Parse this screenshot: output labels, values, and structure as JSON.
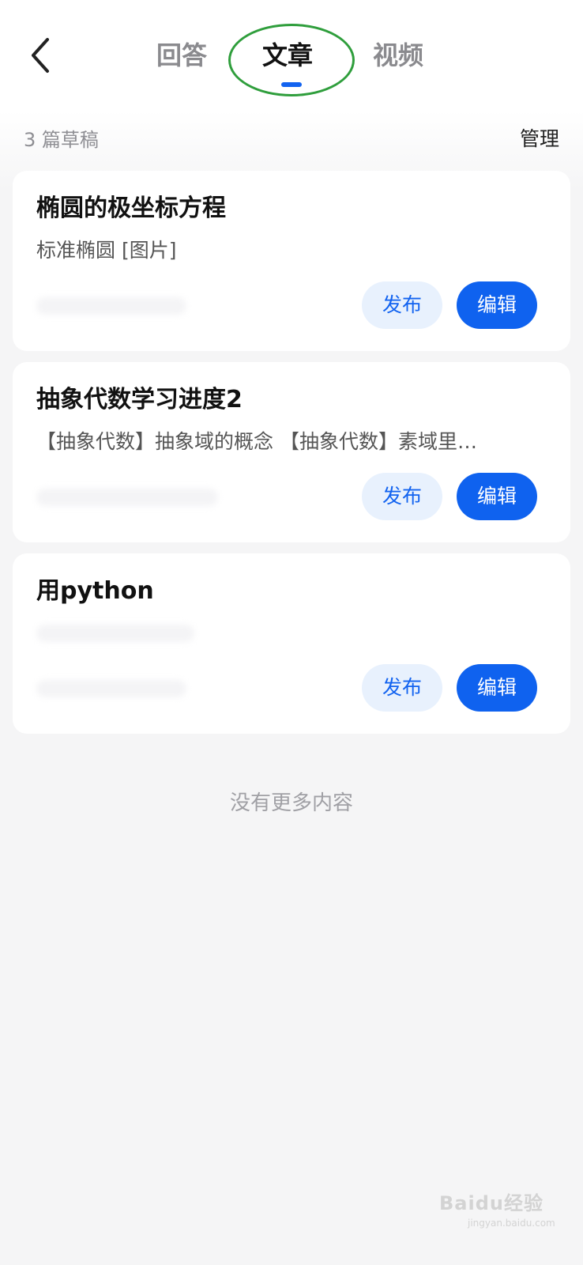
{
  "header": {
    "tabs": [
      {
        "label": "回答",
        "active": false
      },
      {
        "label": "文章",
        "active": true
      },
      {
        "label": "视频",
        "active": false
      }
    ]
  },
  "subheader": {
    "draft_count": "3 篇草稿",
    "manage_label": "管理"
  },
  "drafts": [
    {
      "title": "椭圆的极坐标方程",
      "summary": "标准椭圆 [图片]",
      "publish_label": "发布",
      "edit_label": "编辑"
    },
    {
      "title": "抽象代数学习进度2",
      "summary": "【抽象代数】抽象域的概念 【抽象代数】素域里…",
      "publish_label": "发布",
      "edit_label": "编辑"
    },
    {
      "title": "用python",
      "summary": "",
      "publish_label": "发布",
      "edit_label": "编辑"
    }
  ],
  "footer": {
    "no_more": "没有更多内容"
  },
  "watermark": {
    "text": "Baidu经验",
    "sub": "jingyan.baidu.com"
  },
  "colors": {
    "accent": "#1263f0",
    "publish_bg": "#e8f1fd",
    "highlight": "#2f9e3c"
  }
}
